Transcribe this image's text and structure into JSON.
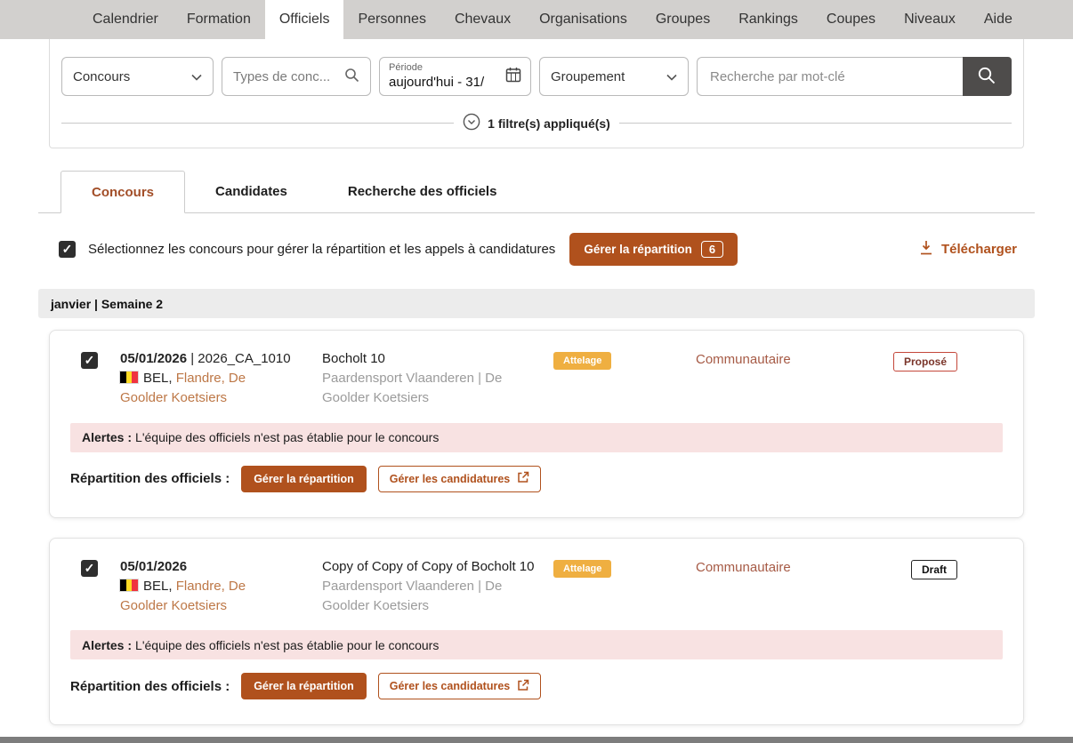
{
  "colors": {
    "accent": "#b0511d",
    "discipline_badge_bg": "#efaf41",
    "link": "#bd7746",
    "category_text": "#a65a45",
    "alert_bg": "#f8e2e2",
    "status_proposed_border": "#c4473a",
    "status_draft_border": "#222222",
    "nav_bg": "#d2d0ce"
  },
  "nav": {
    "items": [
      {
        "label": "Calendrier",
        "active": false
      },
      {
        "label": "Formation",
        "active": false
      },
      {
        "label": "Officiels",
        "active": true
      },
      {
        "label": "Personnes",
        "active": false
      },
      {
        "label": "Chevaux",
        "active": false
      },
      {
        "label": "Organisations",
        "active": false
      },
      {
        "label": "Groupes",
        "active": false
      },
      {
        "label": "Rankings",
        "active": false
      },
      {
        "label": "Coupes",
        "active": false
      },
      {
        "label": "Niveaux",
        "active": false
      },
      {
        "label": "Aide",
        "active": false
      }
    ]
  },
  "filters": {
    "concours_label": "Concours",
    "types_label": "Types de conc...",
    "periode_label": "Période",
    "periode_value": "aujourd'hui - 31/",
    "groupement_label": "Groupement",
    "keyword_placeholder": "Recherche par mot-clé",
    "applied_text": "1 filtre(s) appliqué(s)"
  },
  "tabs": [
    {
      "label": "Concours",
      "active": true
    },
    {
      "label": "Candidates",
      "active": false
    },
    {
      "label": "Recherche des officiels",
      "active": false
    }
  ],
  "toolbar": {
    "select_label": "Sélectionnez les concours pour gérer la répartition et les appels à candidatures",
    "repartition_button": "Gérer la répartition",
    "count": "6",
    "download_label": "Télécharger"
  },
  "group_header": "janvier | Semaine 2",
  "cards": [
    {
      "date": "05/01/2026",
      "code_suffix": " | 2026_CA_1010",
      "country": "BEL",
      "country_sep": ", ",
      "location_links": "Flandre, De Goolder Koetsiers",
      "title": "Bocholt 10",
      "organizer": "Paardensport Vlaanderen | De Goolder Koetsiers",
      "discipline_badge": "Attelage",
      "category": "Communautaire",
      "status": "Proposé",
      "status_variant": "proposed",
      "alert_label": "Alertes :",
      "alert_text": "L'équipe des officiels n'est pas établie pour le concours",
      "repartition_label": "Répartition des officiels :",
      "btn_repartition": "Gérer la répartition",
      "btn_candidatures": "Gérer les candidatures"
    },
    {
      "date": "05/01/2026",
      "code_suffix": "",
      "country": "BEL",
      "country_sep": ", ",
      "location_links": "Flandre, De Goolder Koetsiers",
      "title": "Copy of Copy of Copy of Bocholt 10",
      "organizer": "Paardensport Vlaanderen | De Goolder Koetsiers",
      "discipline_badge": "Attelage",
      "category": "Communautaire",
      "status": "Draft",
      "status_variant": "draft",
      "alert_label": "Alertes :",
      "alert_text": "L'équipe des officiels n'est pas établie pour le concours",
      "repartition_label": "Répartition des officiels :",
      "btn_repartition": "Gérer la répartition",
      "btn_candidatures": "Gérer les candidatures"
    }
  ]
}
